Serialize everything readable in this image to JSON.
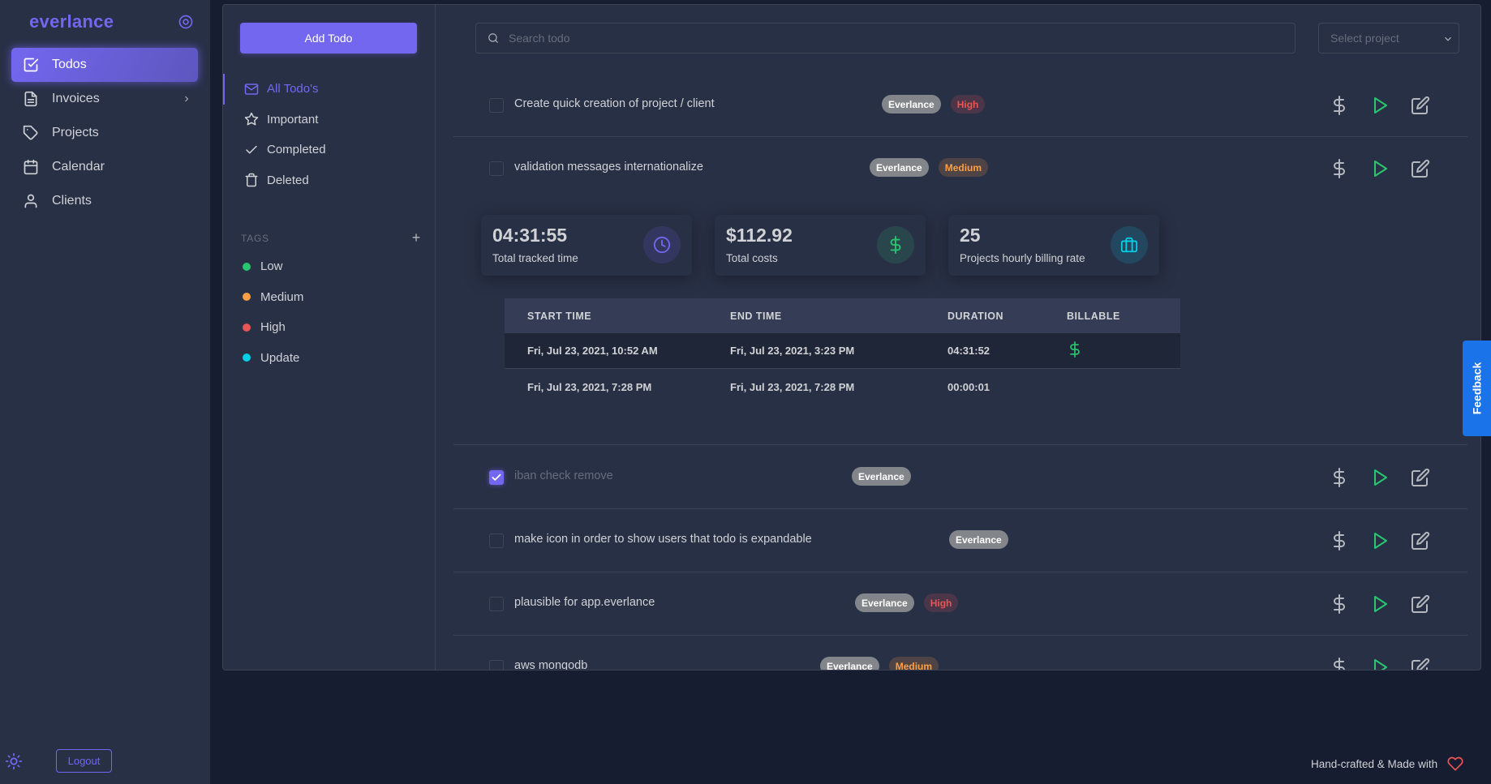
{
  "brand": "everlance",
  "nav": [
    {
      "label": "Todos",
      "icon": "check-square-icon"
    },
    {
      "label": "Invoices",
      "icon": "file-text-icon"
    },
    {
      "label": "Projects",
      "icon": "tag-icon"
    },
    {
      "label": "Calendar",
      "icon": "calendar-icon"
    },
    {
      "label": "Clients",
      "icon": "user-icon"
    }
  ],
  "logout": "Logout",
  "add_todo": "Add Todo",
  "filters": [
    {
      "label": "All Todo's",
      "icon": "mail-icon"
    },
    {
      "label": "Important",
      "icon": "star-icon"
    },
    {
      "label": "Completed",
      "icon": "check-icon"
    },
    {
      "label": "Deleted",
      "icon": "trash-icon"
    }
  ],
  "tags_heading": "TAGS",
  "tags": [
    {
      "label": "Low",
      "color": "#28c76f"
    },
    {
      "label": "Medium",
      "color": "#ff9f43"
    },
    {
      "label": "High",
      "color": "#ea5455"
    },
    {
      "label": "Update",
      "color": "#00cfe8"
    }
  ],
  "search": {
    "placeholder": "Search todo"
  },
  "project_select": {
    "placeholder": "Select project"
  },
  "todos": [
    {
      "title": "Create quick creation of project / client",
      "project": "Everlance",
      "priority": "High",
      "checked": false
    },
    {
      "title": "validation messages internationalize",
      "project": "Everlance",
      "priority": "Medium",
      "checked": false
    },
    {
      "title": "iban check remove",
      "project": "Everlance",
      "priority": "",
      "checked": true
    },
    {
      "title": "make icon in order to show users that todo is expandable",
      "project": "Everlance",
      "priority": "",
      "checked": false
    },
    {
      "title": "plausible for app.everlance",
      "project": "Everlance",
      "priority": "High",
      "checked": false
    },
    {
      "title": "aws mongodb",
      "project": "Everlance",
      "priority": "Medium",
      "checked": false
    }
  ],
  "stats": [
    {
      "value": "04:31:55",
      "label": "Total tracked time",
      "icon": "clock-icon"
    },
    {
      "value": "$112.92",
      "label": "Total costs",
      "icon": "dollar-icon"
    },
    {
      "value": "25",
      "label": "Projects hourly billing rate",
      "icon": "briefcase-icon"
    }
  ],
  "time_table": {
    "headers": [
      "START TIME",
      "END TIME",
      "DURATION",
      "BILLABLE"
    ],
    "rows": [
      {
        "start": "Fri, Jul 23, 2021, 10:52 AM",
        "end": "Fri, Jul 23, 2021, 3:23 PM",
        "duration": "04:31:52",
        "billable": true
      },
      {
        "start": "Fri, Jul 23, 2021, 7:28 PM",
        "end": "Fri, Jul 23, 2021, 7:28 PM",
        "duration": "00:00:01",
        "billable": false
      }
    ]
  },
  "feedback": "Feedback",
  "footer": "Hand-crafted & Made with",
  "colors": {
    "accent": "#7367f0",
    "success": "#28c76f",
    "danger": "#ea5455",
    "warning": "#ff9f43",
    "info": "#00cfe8"
  }
}
